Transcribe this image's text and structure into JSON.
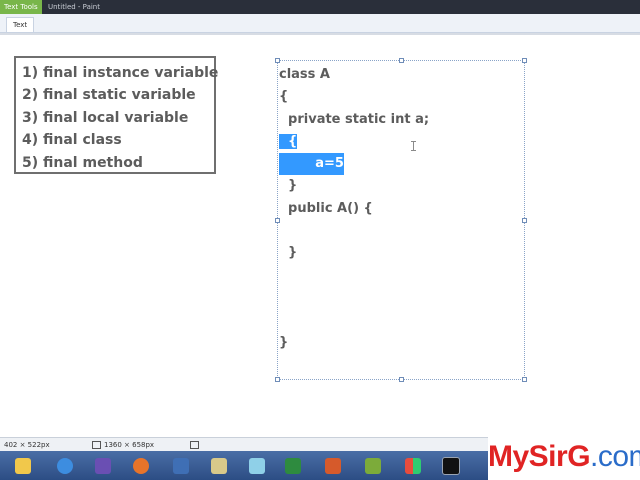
{
  "app": {
    "context_tab": "Text Tools",
    "document_title": "Untitled - Paint",
    "ribbon_tab": "Text"
  },
  "list": {
    "items": [
      "1) final instance variable",
      "2) final static variable",
      "3) final local variable",
      "4) final class",
      "5) final method"
    ]
  },
  "code": {
    "lines": [
      "class A",
      "{",
      "  private static int a;",
      "  {",
      "        a=5;",
      "  }",
      "  public A() {",
      "",
      "  }",
      "",
      "",
      "",
      "}"
    ],
    "selected_lines": [
      3,
      4
    ]
  },
  "status": {
    "selection_size": "402 × 522px",
    "image_size": "1360 × 658px"
  },
  "taskbar": {
    "icons": [
      "windows-explorer-icon",
      "internet-explorer-icon",
      "visual-studio-icon",
      "firefox-icon",
      "media-player-icon",
      "paint-icon",
      "virtual-pc-icon",
      "excel-icon",
      "powerpoint-icon",
      "camtasia-icon",
      "control-panel-icon",
      "command-prompt-icon"
    ]
  },
  "brand": {
    "part1": "MySirG",
    "part2": ".com"
  },
  "colors": {
    "selection": "#3399ff",
    "brand_red": "#e02424",
    "brand_blue": "#2a6cc9",
    "text_gray": "#5c5c5c"
  }
}
